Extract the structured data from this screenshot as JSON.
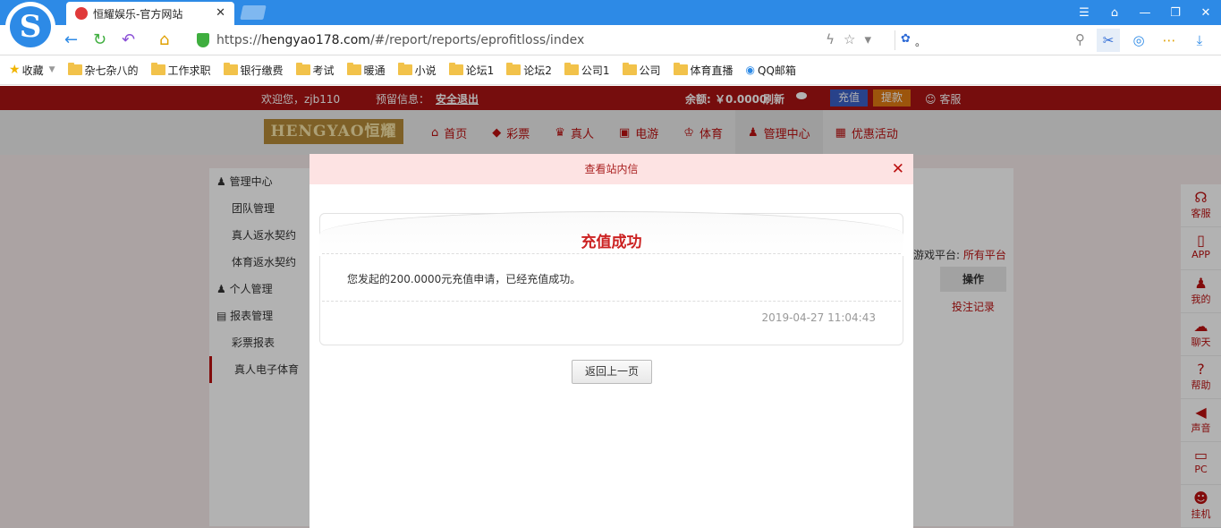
{
  "browser": {
    "tab_title": "恒耀娱乐-官方网站",
    "url_prefix": "https://",
    "url_host": "hengyao178.com",
    "url_path": "/#/report/reports/eprofitloss/index",
    "search_text": "。",
    "bookmarks": [
      "收藏",
      "杂七杂八的",
      "工作求职",
      "银行缴费",
      "考试",
      "暖通",
      "小说",
      "论坛1",
      "论坛2",
      "公司1",
      "公司",
      "体育直播",
      "QQ邮箱"
    ]
  },
  "site": {
    "greeting": "欢迎您，zjb110",
    "warning_label": "预留信息：",
    "logout": "安全退出",
    "balance": "余额: ￥0.0000",
    "refresh": "刷新",
    "deposit": "充值",
    "withdraw": "提款",
    "service": "客服",
    "brand": "HENGYAO恒耀",
    "menu": [
      {
        "label": "首页",
        "icon": "home-icon"
      },
      {
        "label": "彩票",
        "icon": "lottery-icon"
      },
      {
        "label": "真人",
        "icon": "live-icon"
      },
      {
        "label": "电游",
        "icon": "slots-icon"
      },
      {
        "label": "体育",
        "icon": "trophy-icon"
      },
      {
        "label": "管理中心",
        "icon": "users-icon"
      },
      {
        "label": "优惠活动",
        "icon": "gift-icon"
      }
    ],
    "sidebar": [
      "管理中心",
      "团队管理",
      "真人返水契约",
      "体育返水契约",
      "个人管理",
      "报表管理",
      "彩票报表",
      "真人电子体育"
    ],
    "platform_label": "游戏平台:",
    "platform_value": "所有平台",
    "table_header": "操作",
    "table_link": "投注记录",
    "right_bar": [
      "客服",
      "APP",
      "我的",
      "聊天",
      "帮助",
      "声音",
      "PC",
      "挂机"
    ]
  },
  "modal": {
    "header": "查看站内信",
    "title": "充值成功",
    "message": "您发起的200.0000元充值申请，已经充值成功。",
    "time": "2019-04-27 11:04:43",
    "back_button": "返回上一页"
  }
}
